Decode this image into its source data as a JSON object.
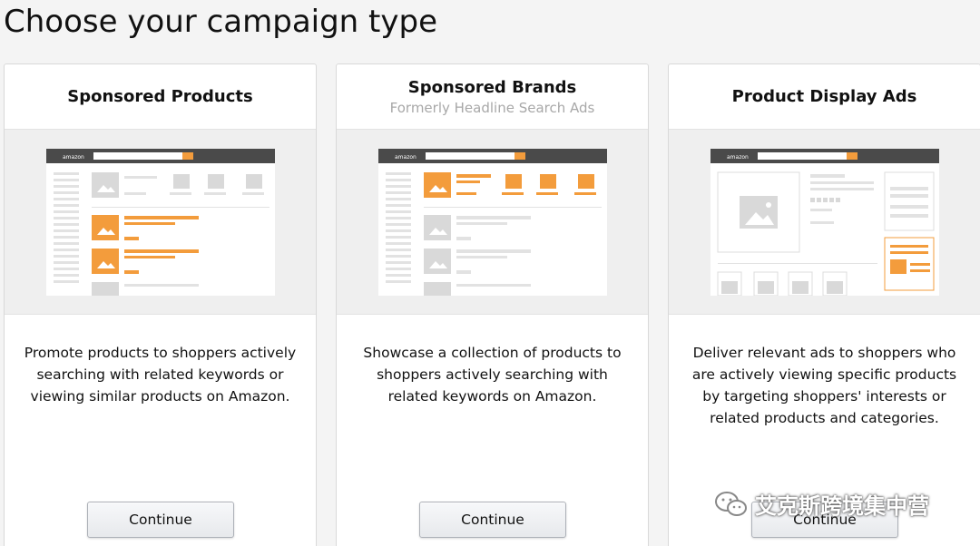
{
  "page": {
    "title": "Choose your campaign type"
  },
  "cards": [
    {
      "title": "Sponsored Products",
      "subtitle": "",
      "description": "Promote products to shoppers actively searching with related keywords or viewing similar products on Amazon.",
      "button_label": "Continue"
    },
    {
      "title": "Sponsored Brands",
      "subtitle": "Formerly Headline Search Ads",
      "description": "Showcase a collection of products to shoppers actively searching with related keywords on Amazon.",
      "button_label": "Continue"
    },
    {
      "title": "Product Display Ads",
      "subtitle": "",
      "description": "Deliver relevant ads to shoppers who are actively viewing specific products by targeting shoppers' interests or related products and categories.",
      "button_label": "Continue"
    }
  ],
  "preview": {
    "logo_text": "amazon"
  },
  "watermark": {
    "text": "艾克斯跨境集中营"
  },
  "colors": {
    "accent": "#f39c3c",
    "header_bar": "#4a4a4a",
    "placeholder": "#d6d6d6"
  }
}
